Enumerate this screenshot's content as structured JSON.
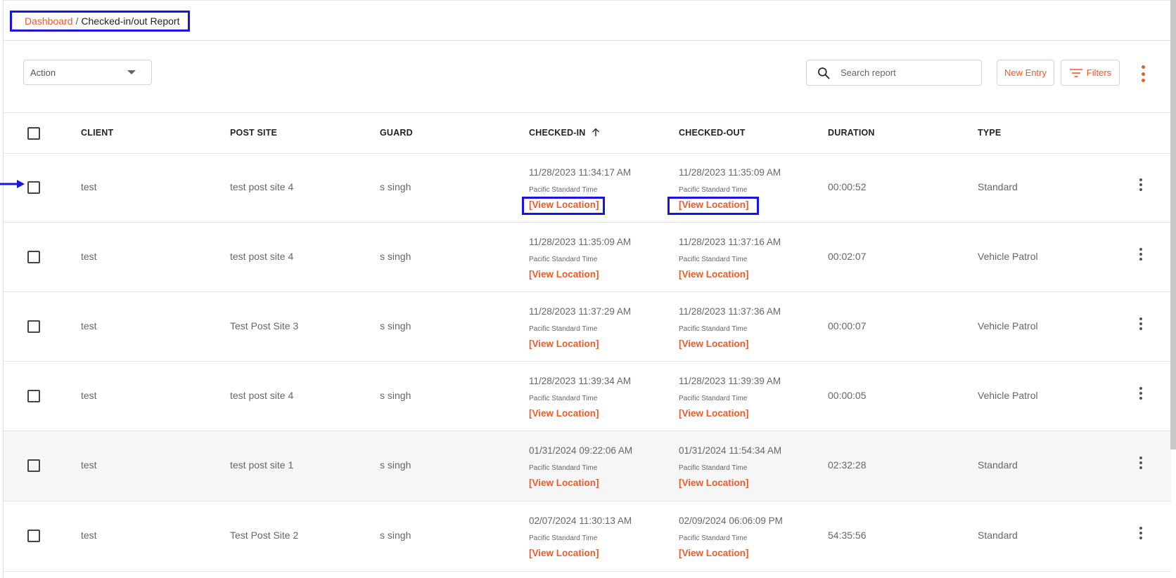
{
  "breadcrumb": {
    "root": "Dashboard",
    "separator": "/",
    "current": "Checked-in/out Report"
  },
  "toolbar": {
    "action_select": "Action",
    "search_placeholder": "Search report",
    "new_entry_label": "New Entry",
    "filters_label": "Filters"
  },
  "columns": {
    "client": "CLIENT",
    "post_site": "POST SITE",
    "guard": "GUARD",
    "checked_in": "CHECKED-IN",
    "checked_out": "CHECKED-OUT",
    "duration": "DURATION",
    "type": "TYPE"
  },
  "rows": [
    {
      "client": "test",
      "post_site": "test post site 4",
      "guard": "s singh",
      "in_time": "11/28/2023 11:34:17 AM",
      "in_tz": "Pacific Standard Time",
      "in_loc": "[View Location]",
      "out_time": "11/28/2023 11:35:09 AM",
      "out_tz": "Pacific Standard Time",
      "out_loc": "[View Location]",
      "duration": "00:00:52",
      "type": "Standard"
    },
    {
      "client": "test",
      "post_site": "test post site 4",
      "guard": "s singh",
      "in_time": "11/28/2023 11:35:09 AM",
      "in_tz": "Pacific Standard Time",
      "in_loc": "[View Location]",
      "out_time": "11/28/2023 11:37:16 AM",
      "out_tz": "Pacific Standard Time",
      "out_loc": "[View Location]",
      "duration": "00:02:07",
      "type": "Vehicle Patrol"
    },
    {
      "client": "test",
      "post_site": "Test Post Site 3",
      "guard": "s singh",
      "in_time": "11/28/2023 11:37:29 AM",
      "in_tz": "Pacific Standard Time",
      "in_loc": "[View Location]",
      "out_time": "11/28/2023 11:37:36 AM",
      "out_tz": "Pacific Standard Time",
      "out_loc": "[View Location]",
      "duration": "00:00:07",
      "type": "Vehicle Patrol"
    },
    {
      "client": "test",
      "post_site": "test post site 4",
      "guard": "s singh",
      "in_time": "11/28/2023 11:39:34 AM",
      "in_tz": "Pacific Standard Time",
      "in_loc": "[View Location]",
      "out_time": "11/28/2023 11:39:39 AM",
      "out_tz": "Pacific Standard Time",
      "out_loc": "[View Location]",
      "duration": "00:00:05",
      "type": "Vehicle Patrol"
    },
    {
      "client": "test",
      "post_site": "test post site 1",
      "guard": "s singh",
      "in_time": "01/31/2024 09:22:06 AM",
      "in_tz": "Pacific Standard Time",
      "in_loc": "[View Location]",
      "out_time": "01/31/2024 11:54:34 AM",
      "out_tz": "Pacific Standard Time",
      "out_loc": "[View Location]",
      "duration": "02:32:28",
      "type": "Standard"
    },
    {
      "client": "test",
      "post_site": "Test Post Site 2",
      "guard": "s singh",
      "in_time": "02/07/2024 11:30:13 AM",
      "in_tz": "Pacific Standard Time",
      "in_loc": "[View Location]",
      "out_time": "02/09/2024 06:06:09 PM",
      "out_tz": "Pacific Standard Time",
      "out_loc": "[View Location]",
      "duration": "54:35:56",
      "type": "Standard"
    }
  ]
}
